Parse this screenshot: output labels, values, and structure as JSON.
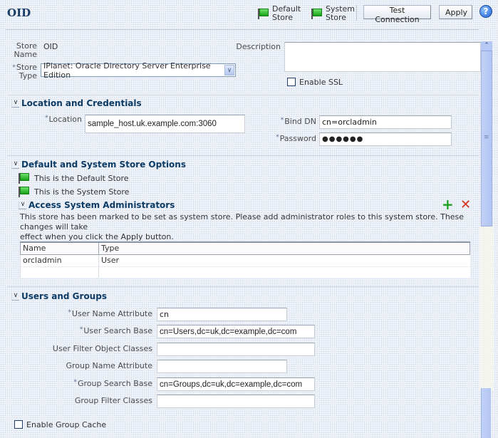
{
  "header": {
    "title": "OID",
    "default_store_label": [
      "Default",
      "Store"
    ],
    "system_store_label": [
      "System",
      "Store"
    ],
    "test_connection_label": "Test Connection",
    "apply_label": "Apply",
    "help_icon": "?"
  },
  "store": {
    "name_label": [
      "Store",
      "Name"
    ],
    "name_value": "OID",
    "type_label": [
      "Store",
      "Type"
    ],
    "type_value": "IPlanet: Oracle Directory Server Enterprise Edition",
    "description_label": "Description",
    "description_value": "",
    "enable_ssl_label": "Enable SSL",
    "enable_ssl_checked": false
  },
  "location": {
    "section_title": "Location and Credentials",
    "location_label": "Location",
    "location_value": "sample_host.uk.example.com:3060",
    "bind_dn_label": "Bind DN",
    "bind_dn_value": "cn=orcladmin",
    "password_label": "Password",
    "password_value": "●●●●●●"
  },
  "store_options": {
    "section_title": "Default and System Store Options",
    "default_store_text": "This is the Default Store",
    "system_store_text": "This is the System Store"
  },
  "admins": {
    "section_title": "Access System Administrators",
    "info_line1": "This store has been marked to be set as system store. Please add administrator roles to this system store. These changes will take",
    "info_line2": "effect when you click the Apply button.",
    "columns": [
      "Name",
      "Type"
    ],
    "rows": [
      {
        "name": "orcladmin",
        "type": "User"
      }
    ]
  },
  "users_groups": {
    "section_title": "Users and Groups",
    "fields": [
      {
        "label": "User Name Attribute",
        "required": true,
        "value": "cn"
      },
      {
        "label": "User Search Base",
        "required": true,
        "value": "cn=Users,dc=uk,dc=example,dc=com"
      },
      {
        "label": "User Filter Object Classes",
        "required": false,
        "value": ""
      },
      {
        "label": "Group Name Attribute",
        "required": false,
        "value": ""
      },
      {
        "label": "Group Search Base",
        "required": true,
        "value": "cn=Groups,dc=uk,dc=example,dc=com"
      },
      {
        "label": "Group Filter Classes",
        "required": false,
        "value": ""
      }
    ],
    "enable_group_cache_label": "Enable Group Cache",
    "enable_group_cache_checked": false
  },
  "required_marker": "*"
}
